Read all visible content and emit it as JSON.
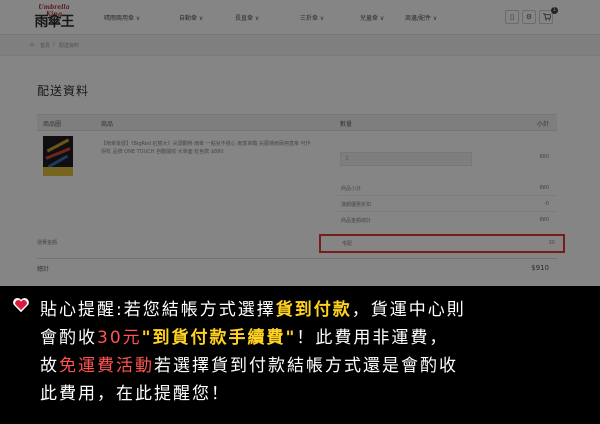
{
  "header": {
    "logo_small": "Umbrella King",
    "logo_main": "雨傘王",
    "menu": [
      "晴雨兩用傘 ∨",
      "自動傘 ∨",
      "長直傘 ∨",
      "三折傘 ∨",
      "兒童傘 ∨",
      "周邊/配件 ∨"
    ],
    "icons": [
      "book-icon",
      "gear-icon",
      "cart-icon"
    ],
    "cart_count": "1"
  },
  "breadcrumb": [
    "首頁",
    "配送資料"
  ],
  "page_title": "配送資料",
  "table": {
    "headers": {
      "image": "商品圖",
      "product": "商品",
      "quantity": "數量",
      "subtotal": "小計"
    },
    "item": {
      "name": "【雨傘批發】《BigRed 紅樹大》尖頭鋼骨 雨傘 一點兒不擔心 雨季來臨 尖尾晴雨兩用直傘 可作拐杖 品牌 ONE TOUCH 自動開收 大傘面 紅色款 $880",
      "quantity": "1",
      "line_total": "880"
    },
    "summary": [
      {
        "label": "商品小計",
        "value": "880"
      },
      {
        "label": "滿額優惠折扣",
        "value": "-0"
      },
      {
        "label": "商品金額總計",
        "value": "880"
      }
    ],
    "shipping_left_label": "運費金額",
    "shipping": {
      "label": "宅配",
      "value": "30"
    },
    "total": {
      "label": "總計",
      "value": "$910"
    }
  },
  "notice": {
    "line1": [
      "貼心提醒:若您結帳方式選擇",
      "貨到付款",
      "，貨運中心則"
    ],
    "line2": [
      "會酌收",
      "30元",
      "\"到貨付款手續費\"",
      "！此費用非運費，"
    ],
    "line3": [
      "故",
      "免運費活動",
      "若選擇貨到付款結帳方式還是會酌收"
    ],
    "line4": "此費用，在此提醒您！"
  },
  "colors": {
    "highlight_box": "#e53935",
    "notice_yellow": "#ffd21f",
    "notice_red": "#ff5252",
    "notice_bg": "#000000"
  }
}
